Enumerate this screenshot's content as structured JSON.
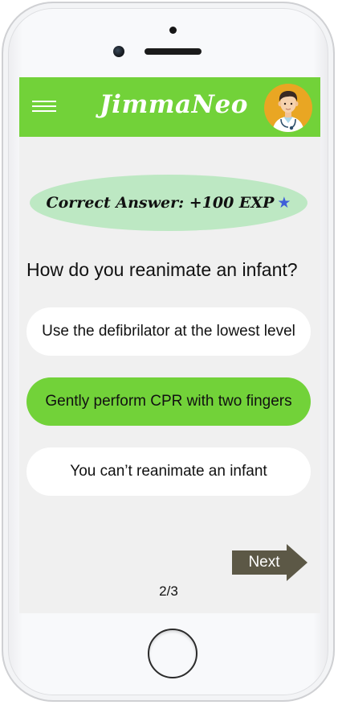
{
  "app": {
    "title": "JimmaNeo"
  },
  "feedback": {
    "text": "Correct Answer: +100 EXP",
    "icon": "star-icon"
  },
  "quiz": {
    "question": "How do you reanimate an infant?",
    "answers": [
      {
        "label": "Use the defibrilator at the lowest level",
        "selected": false
      },
      {
        "label": "Gently perform CPR with two fingers",
        "selected": true
      },
      {
        "label": "You can’t reanimate an infant",
        "selected": false
      }
    ],
    "next_label": "Next",
    "progress": "2/3"
  },
  "colors": {
    "brand_green": "#72d239",
    "feedback_bg": "#bde8c3",
    "next_button": "#5c5846",
    "star": "#3f5fd9",
    "avatar_bg": "#e9a623"
  }
}
